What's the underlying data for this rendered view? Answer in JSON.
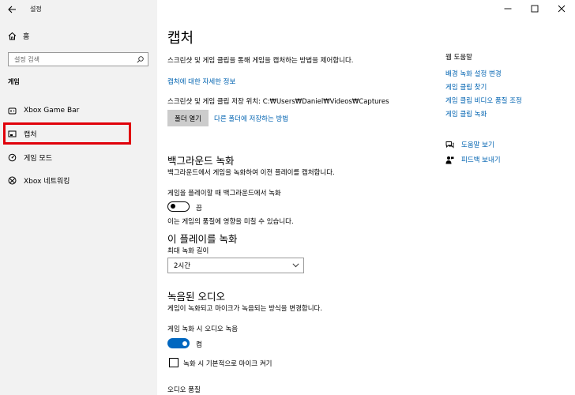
{
  "window": {
    "title": "설정",
    "back_icon": "back-arrow-icon",
    "controls": [
      "minimize-icon",
      "maximize-icon",
      "close-icon"
    ]
  },
  "sidebar": {
    "home_label": "홈",
    "search_placeholder": "설정 검색",
    "section_label": "게임",
    "items": [
      {
        "label": "Xbox Game Bar",
        "icon": "xbox-game-bar-icon"
      },
      {
        "label": "캡처",
        "icon": "captures-icon",
        "selected": true
      },
      {
        "label": "게임 모드",
        "icon": "game-mode-icon"
      },
      {
        "label": "Xbox 네트워킹",
        "icon": "xbox-icon"
      }
    ],
    "highlight_color": "#e0000a"
  },
  "main": {
    "title": "캡처",
    "intro": "스크린샷 및 게임 클립을 통해 게임을 캡처하는 방법을 제어합니다.",
    "more_info_link": "캡처에 대한 자세한 정보",
    "save_location_label": "스크린샷 및 게임 클립 저장 위치: C:₩Users₩Daniel₩Videos₩Captures",
    "open_folder_button": "폴더 열기",
    "move_folder_link": "다른 폴더에 저장하는 방법",
    "background": {
      "heading": "백그라운드 녹화",
      "desc": "백그라운드에서 게임을 녹화하여 이전 플레이를 캡처합니다.",
      "setting_label": "게임을 플레이할 때 백그라운드에서 녹화",
      "toggle_state": "끔",
      "toggle_on": false,
      "note": "이는 게임의 품질에 영향을 미칠 수 있습니다."
    },
    "record_that": {
      "heading": "이 플레이를 녹화",
      "max_label": "최대 녹화 길이",
      "max_value": "2시간"
    },
    "audio": {
      "heading": "녹음된 오디오",
      "desc": "게임이 녹화되고 마이크가 녹음되는 방식을 변경합니다.",
      "setting_label": "게임 녹화 시 오디오 녹음",
      "toggle_state": "켬",
      "toggle_on": true,
      "mic_checkbox_label": "녹화 시 기본적으로 마이크 켜기",
      "mic_checked": false,
      "quality_label": "오디오 품질"
    }
  },
  "help": {
    "heading": "웹 도움말",
    "links": [
      "배경 녹화 설정 변경",
      "게임 클립 찾기",
      "게임 클립 비디오 품질 조정",
      "게임 클립 녹화"
    ],
    "get_help": "도움말 보기",
    "feedback": "피드백 보내기",
    "link_color": "#0063b1",
    "accent_color": "#0067c0"
  }
}
